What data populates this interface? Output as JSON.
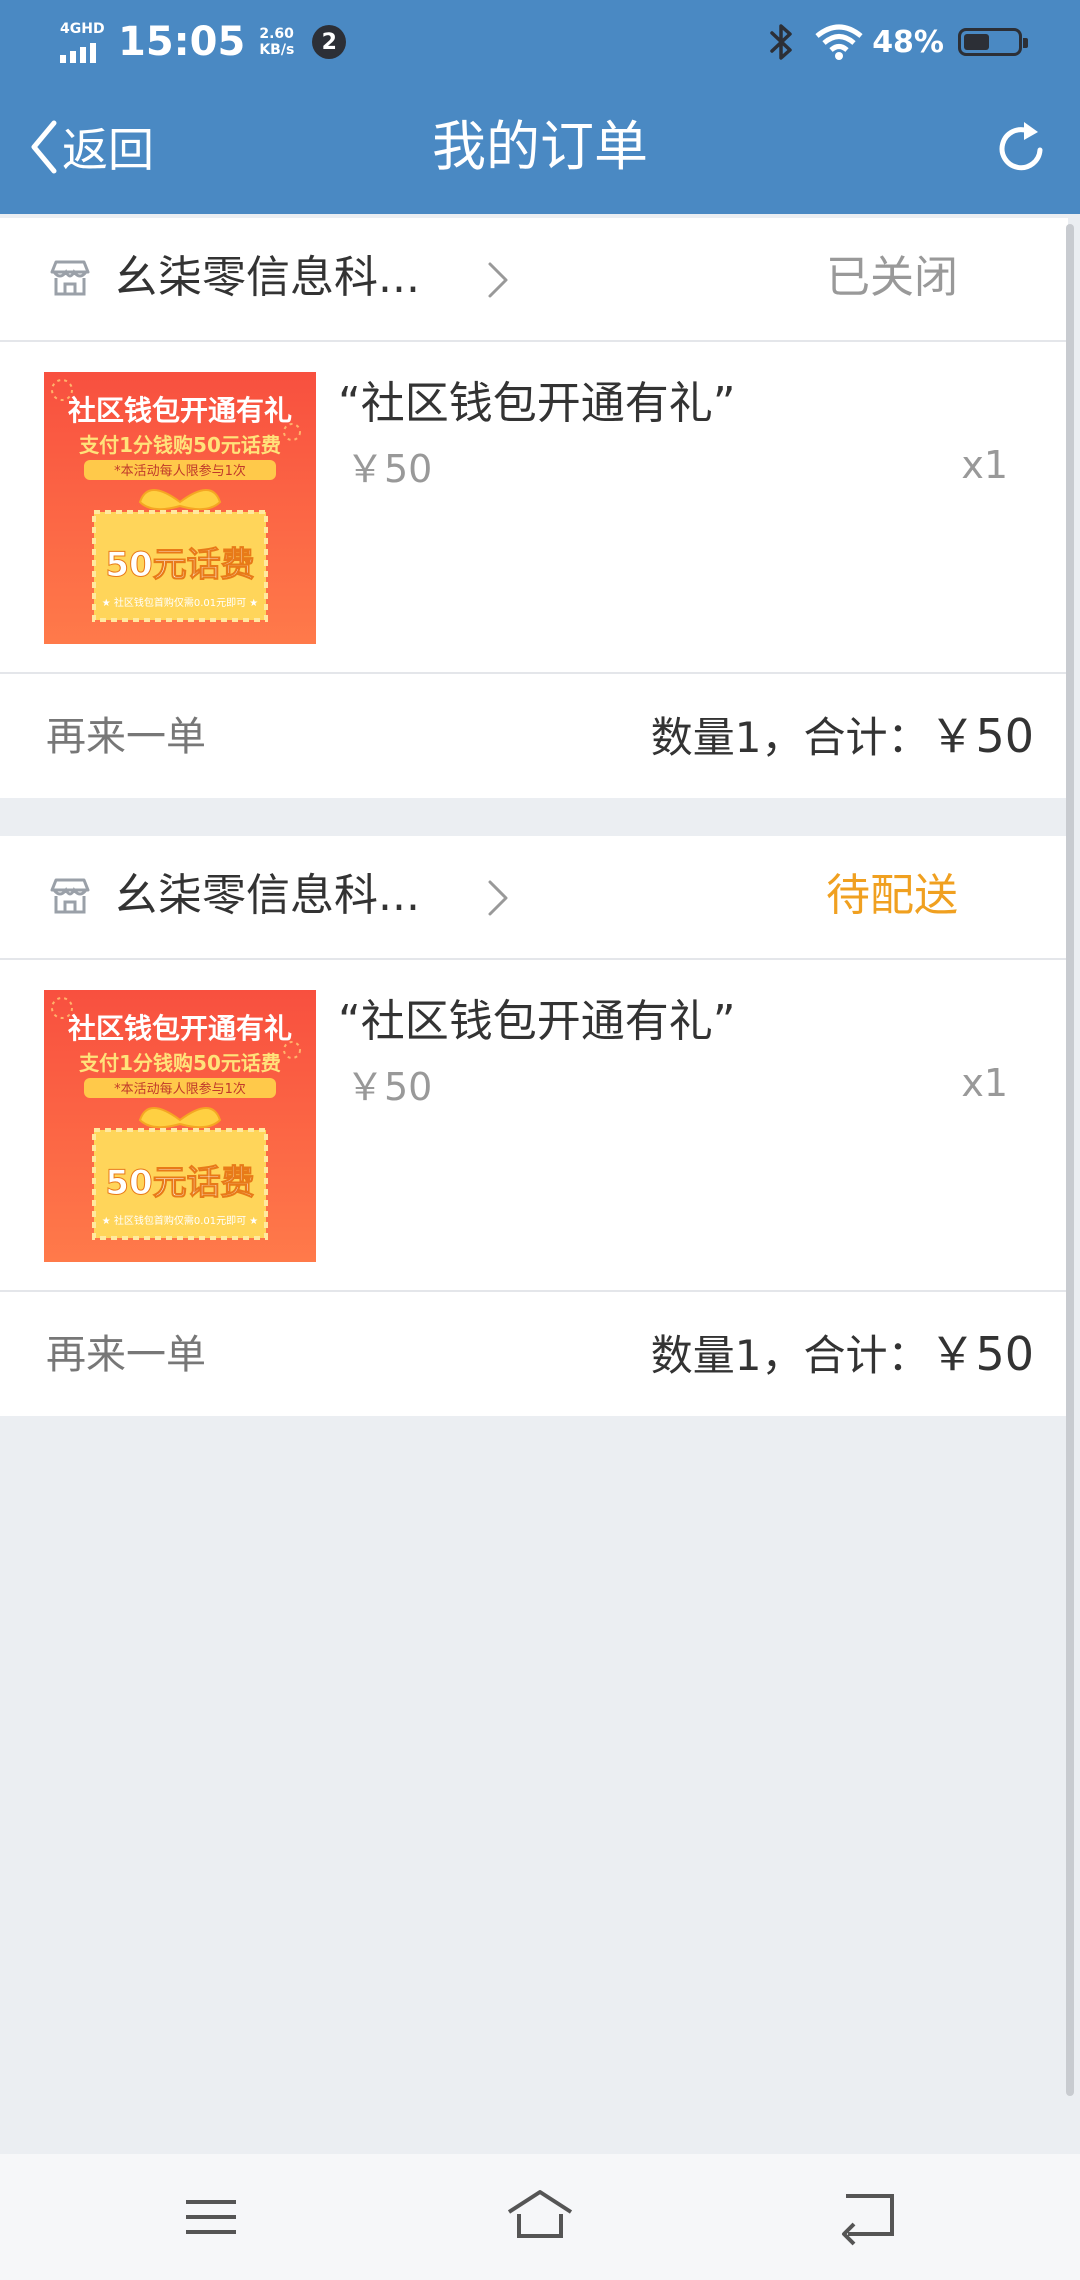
{
  "status_bar": {
    "network": "4GHD",
    "time": "15:05",
    "speed_value": "2.60",
    "speed_unit": "KB/s",
    "notification_count": "2",
    "battery_percent": "48%",
    "battery_level": 0.48
  },
  "header": {
    "back_label": "返回",
    "title": "我的订单",
    "icons": [
      "chevron-left-icon",
      "refresh-icon"
    ]
  },
  "orders": [
    {
      "shop_name": "幺柒零信息科...",
      "status": "已关闭",
      "status_color": "#999999",
      "product": {
        "name": "“社区钱包开通有礼”",
        "price": "￥50",
        "qty": "x1",
        "image": {
          "line1": "社区钱包开通有礼",
          "line2": "支付1分钱购50元话费",
          "line3": "*本活动每人限参与1次",
          "big": "50元话费",
          "small": "★ 社区钱包首购仅需0.01元即可 ★"
        }
      },
      "reorder_label": "再来一单",
      "summary": "数量1，合计：",
      "total": "￥50"
    },
    {
      "shop_name": "幺柒零信息科...",
      "status": "待配送",
      "status_color": "#f0a020",
      "product": {
        "name": "“社区钱包开通有礼”",
        "price": "￥50",
        "qty": "x1",
        "image": {
          "line1": "社区钱包开通有礼",
          "line2": "支付1分钱购50元话费",
          "line3": "*本活动每人限参与1次",
          "big": "50元话费",
          "small": "★ 社区钱包首购仅需0.01元即可 ★"
        }
      },
      "reorder_label": "再来一单",
      "summary": "数量1，合计：",
      "total": "￥50"
    }
  ],
  "bottom_nav": [
    "menu-icon",
    "home-icon",
    "back-icon"
  ],
  "colors": {
    "header_bg": "#4a89c3",
    "page_bg": "#ebeef2",
    "accent_orange": "#f0a020"
  }
}
